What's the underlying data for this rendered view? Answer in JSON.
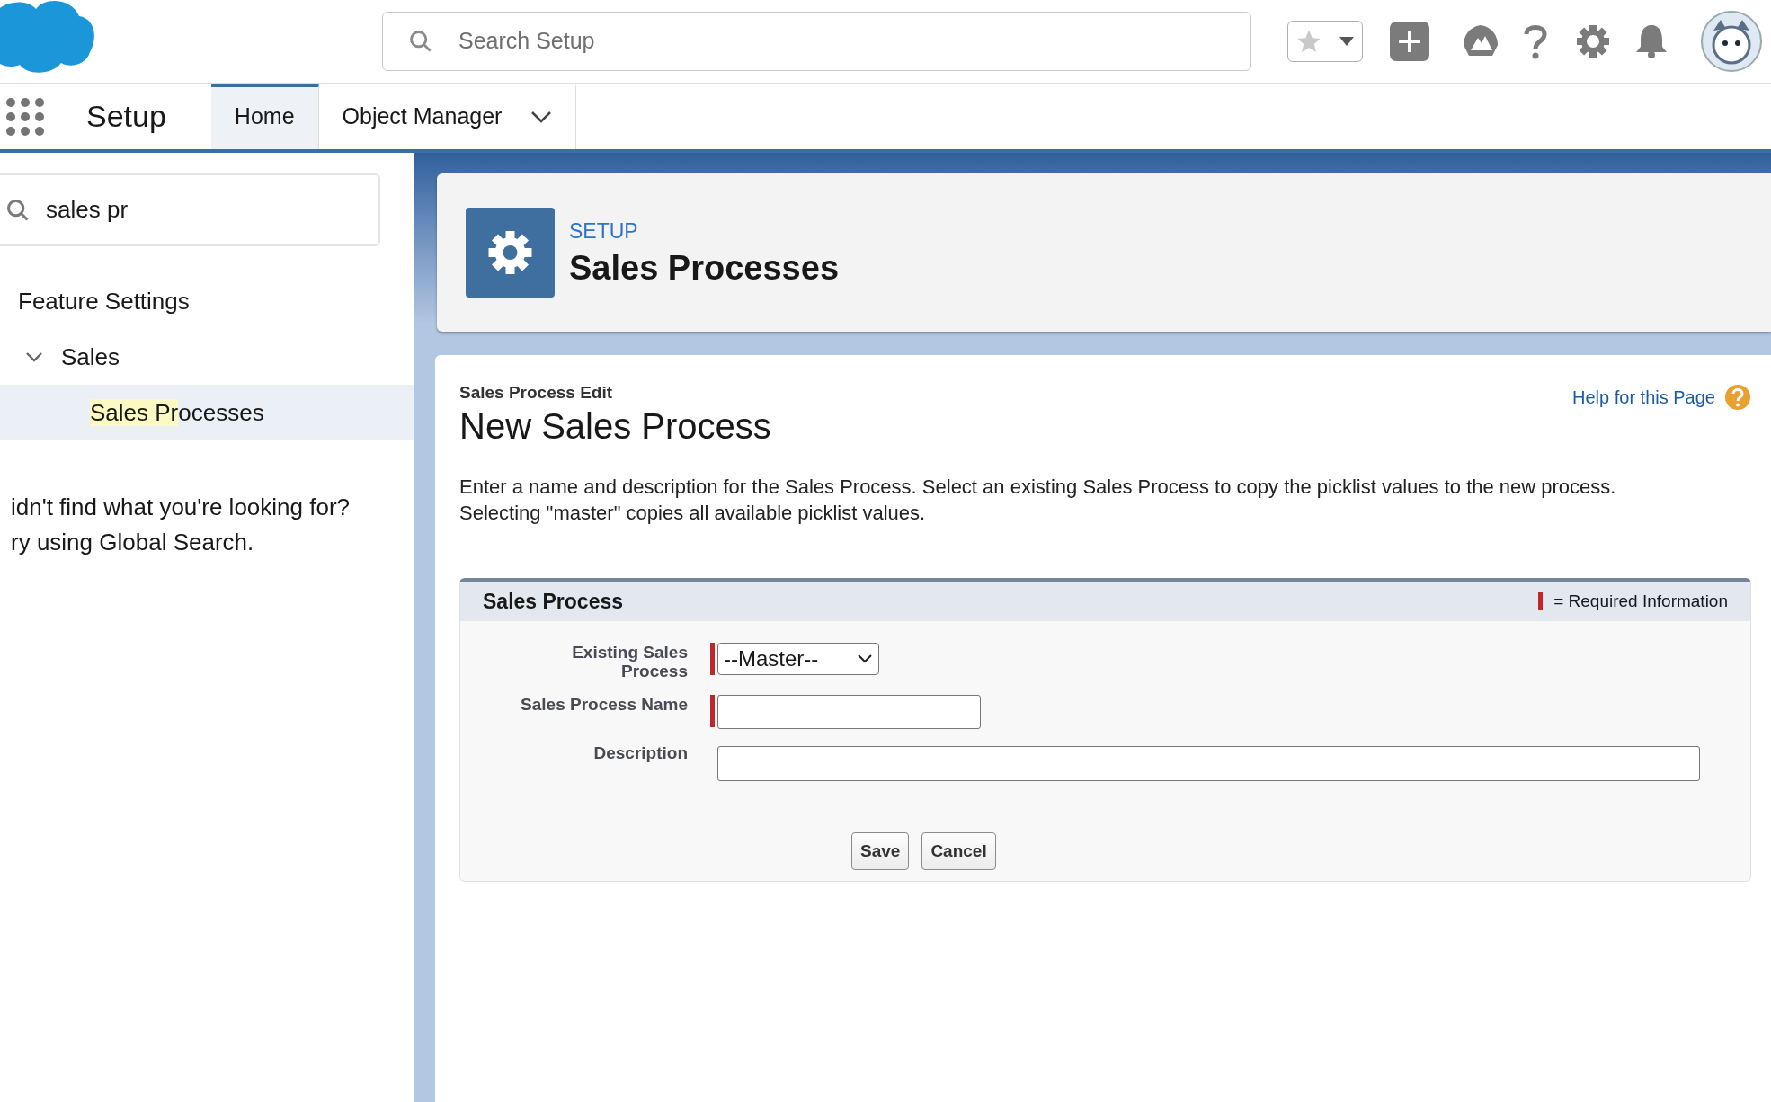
{
  "global_header": {
    "search": {
      "placeholder": "Search Setup"
    }
  },
  "nav": {
    "app_name": "Setup",
    "tabs": [
      {
        "label": "Home",
        "selected": true,
        "dropdown": false
      },
      {
        "label": "Object Manager",
        "selected": false,
        "dropdown": true
      }
    ]
  },
  "sidebar": {
    "search": {
      "value": "sales pr"
    },
    "tree": [
      {
        "label": "Feature Settings",
        "selected": false,
        "children": [
          {
            "label": "Sales",
            "expanded": true,
            "selected": false,
            "children": [
              {
                "label": "ocesses",
                "match": "Sales Pr",
                "selected": true
              }
            ]
          }
        ]
      }
    ],
    "not_found": [
      "idn't find what you're looking for?",
      "ry using Global Search."
    ]
  },
  "page_header": {
    "eyebrow": "SETUP",
    "title": "Sales Processes"
  },
  "form": {
    "subtitle": "Sales Process Edit",
    "title": "New Sales Process",
    "help_link": "Help for this Page",
    "intro": "Enter a name and description for the Sales Process. Select an existing Sales Process to copy the picklist values to the new process. Selecting \"master\" copies all available picklist values.",
    "section": {
      "title": "Sales Process",
      "required_legend": "= Required Information",
      "fields": [
        {
          "kind": "select",
          "label": "Existing Sales Process",
          "required": true,
          "value": "--Master--"
        },
        {
          "kind": "text",
          "label": "Sales Process Name",
          "required": true
        },
        {
          "kind": "wide_text",
          "label": "Description",
          "required": false
        }
      ],
      "buttons": [
        "Save",
        "Cancel"
      ]
    }
  }
}
